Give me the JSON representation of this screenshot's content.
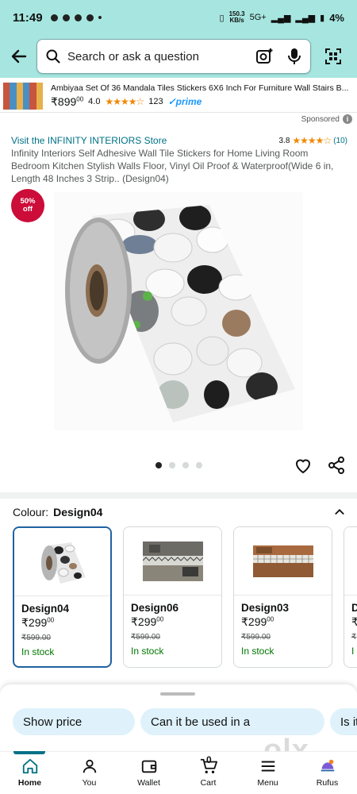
{
  "status_bar": {
    "time": "11:49",
    "network_speed": "150.3\nKB/s",
    "network_type": "5G+",
    "battery": "4%"
  },
  "search": {
    "placeholder": "Search or ask a question"
  },
  "sponsored_ad": {
    "title": "Ambiyaa Set Of 36 Mandala Tiles Stickers 6X6 Inch For Furniture Wall Stairs B...",
    "price": "₹899",
    "price_fraction": "00",
    "rating": "4.0",
    "stars": "★★★★☆",
    "review_count": "123",
    "prime": "✓prime",
    "sponsored_label": "Sponsored"
  },
  "product": {
    "store_link": "Visit the INFINITY INTERIORS Store",
    "rating": "3.8",
    "stars": "★★★★☆",
    "rating_count": "(10)",
    "title": "Infinity Interiors Self Adhesive Wall Tile Stickers for Home Living Room Bedroom Kitchen Stylish Walls Floor, Vinyl Oil Proof & Waterproof(Wide 6 in, Length 48 Inches 3 Strip.. (Design04)",
    "discount_pct": "50%",
    "discount_word": "off"
  },
  "colour_selector": {
    "label": "Colour:",
    "selected": "Design04",
    "variants": [
      {
        "name": "Design04",
        "price": "₹299",
        "price_fraction": "00",
        "mrp": "₹599.00",
        "stock": "In stock"
      },
      {
        "name": "Design06",
        "price": "₹299",
        "price_fraction": "00",
        "mrp": "₹599.00",
        "stock": "In stock"
      },
      {
        "name": "Design03",
        "price": "₹299",
        "price_fraction": "00",
        "mrp": "₹599.00",
        "stock": "In stock"
      },
      {
        "name": "D",
        "price": "₹",
        "price_fraction": "",
        "mrp": "₹",
        "stock": "I"
      }
    ]
  },
  "assistant_chips": [
    {
      "label": "Show price"
    },
    {
      "label": "Can it be used in a"
    },
    {
      "label": "Is it"
    }
  ],
  "nav": {
    "items": [
      {
        "label": "Home"
      },
      {
        "label": "You"
      },
      {
        "label": "Wallet"
      },
      {
        "label": "Cart"
      },
      {
        "label": "Menu"
      },
      {
        "label": "Rufus"
      }
    ],
    "cart_count": "0"
  },
  "watermark": "olx",
  "colors": {
    "header_bg": "#a7e6e0",
    "link": "#007185",
    "discount_badge": "#cc0c39",
    "in_stock": "#007600",
    "chip_bg": "#dff2fb",
    "star": "#f08804"
  }
}
